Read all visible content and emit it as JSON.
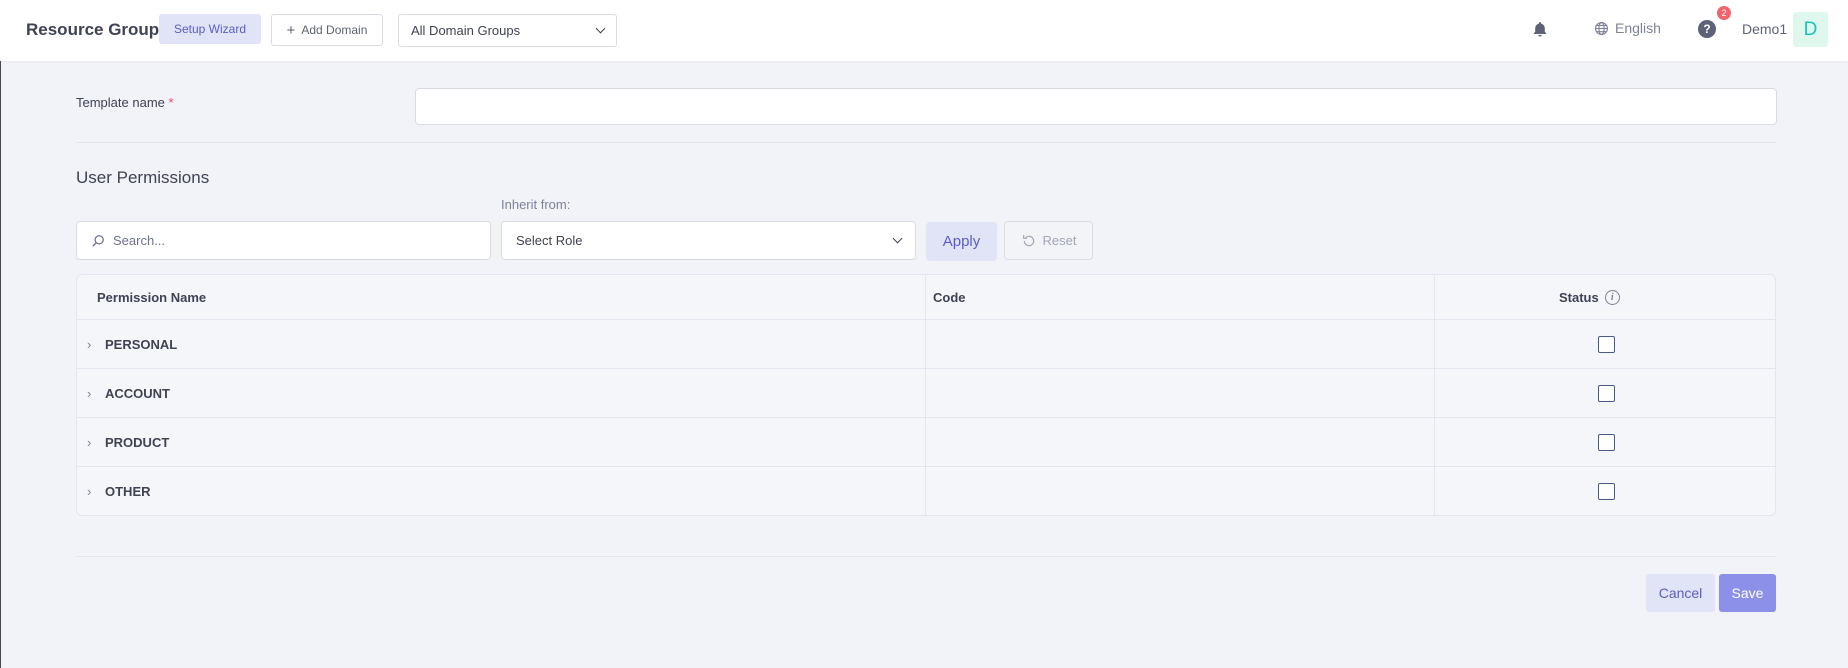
{
  "header": {
    "title": "Resource Groups",
    "setup_wizard": "Setup Wizard",
    "add_domain": "Add Domain",
    "domain_group_selected": "All Domain Groups",
    "language": "English",
    "help_badge": "2",
    "help_glyph": "?",
    "username": "Demo1",
    "avatar_letter": "D"
  },
  "form": {
    "template_name_label": "Template name",
    "required_mark": "*",
    "template_name_value": ""
  },
  "permissions": {
    "section_title": "User Permissions",
    "search_placeholder": "Search...",
    "inherit_label": "Inherit from:",
    "role_selected": "Select Role",
    "apply_label": "Apply",
    "reset_label": "Reset",
    "columns": {
      "name": "Permission Name",
      "code": "Code",
      "status": "Status"
    },
    "info_glyph": "i",
    "rows": [
      {
        "name": "PERSONAL",
        "code": "",
        "checked": false
      },
      {
        "name": "ACCOUNT",
        "code": "",
        "checked": false
      },
      {
        "name": "PRODUCT",
        "code": "",
        "checked": false
      },
      {
        "name": "OTHER",
        "code": "",
        "checked": false
      }
    ]
  },
  "footer": {
    "cancel_label": "Cancel",
    "save_label": "Save"
  },
  "colors": {
    "accent": "#5b5ec7",
    "save_bg": "#8c90e8",
    "badge": "#f1646a",
    "avatar_text": "#1bc5bd"
  },
  "icons": {
    "bell": "bell-icon",
    "globe": "globe-icon",
    "help": "help-icon",
    "search": "search-icon",
    "reset": "refresh-icon",
    "chevron": "chevron-down-icon",
    "expander": "chevron-right-icon",
    "info": "info-icon",
    "plus": "plus-icon"
  }
}
